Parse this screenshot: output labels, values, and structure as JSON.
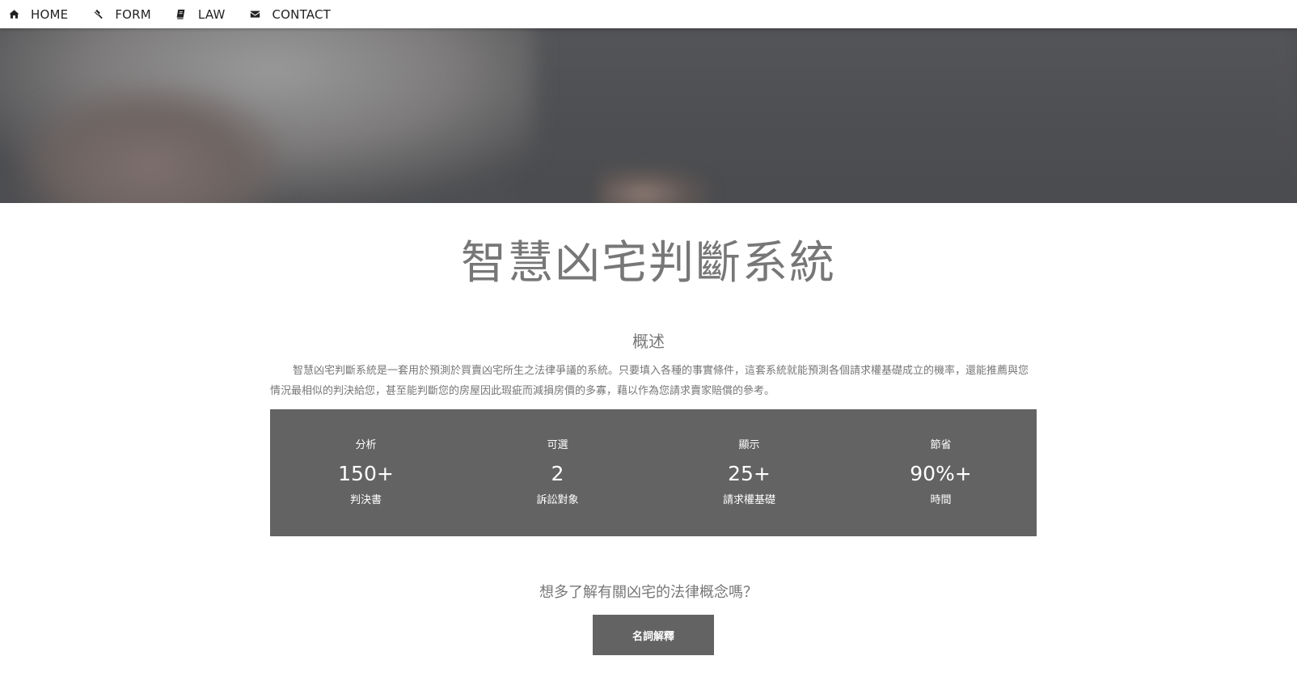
{
  "nav": {
    "items": [
      {
        "label": "HOME",
        "icon": "home-icon"
      },
      {
        "label": "FORM",
        "icon": "gavel-icon"
      },
      {
        "label": "LAW",
        "icon": "book-icon"
      },
      {
        "label": "CONTACT",
        "icon": "envelope-icon"
      }
    ]
  },
  "main": {
    "title": "智慧凶宅判斷系統",
    "section_heading": "概述",
    "overview": "智慧凶宅判斷系統是一套用於預測於買賣凶宅所生之法律爭議的系統。只要填入各種的事實條件，這套系統就能預測各個請求權基礎成立的機率，還能推薦與您情況最相似的判決給您，甚至能判斷您的房屋因此瑕疵而減損房價的多寡，藉以作為您請求賣家賠償的參考。"
  },
  "stats": [
    {
      "top": "分析",
      "value": "150+",
      "bottom": "判決書"
    },
    {
      "top": "可選",
      "value": "2",
      "bottom": "訴訟對象"
    },
    {
      "top": "顯示",
      "value": "25+",
      "bottom": "請求權基礎"
    },
    {
      "top": "節省",
      "value": "90%+",
      "bottom": "時間"
    }
  ],
  "cta": {
    "question": "想多了解有關凶宅的法律概念嗎？",
    "button_label": "名詞解釋"
  },
  "colors": {
    "panel": "#636363",
    "text_muted": "#777777",
    "nav_text": "#222222"
  }
}
